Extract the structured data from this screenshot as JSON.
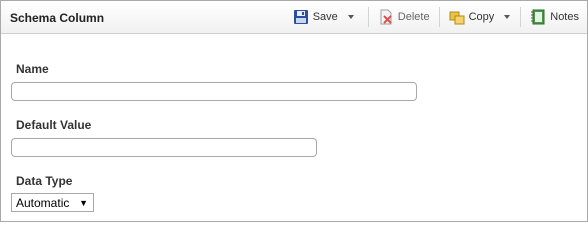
{
  "header": {
    "title": "Schema Column"
  },
  "toolbar": {
    "save_label": "Save",
    "delete_label": "Delete",
    "copy_label": "Copy",
    "notes_label": "Notes"
  },
  "form": {
    "name_label": "Name",
    "name_value": "",
    "default_value_label": "Default Value",
    "default_value_value": "",
    "data_type_label": "Data Type",
    "data_type_selected": "Automatic",
    "dropdown_caret": "▼"
  },
  "colors": {
    "border": "#a9a9a9",
    "header_bg": "#f1f1f1",
    "save_icon": "#2a4f9c",
    "delete_icon": "#c0392b",
    "copy_icon": "#d4a017",
    "notes_icon": "#3c8d3c"
  },
  "icons": {
    "save": "floppy-disk-icon",
    "delete": "delete-document-icon",
    "copy": "copy-folders-icon",
    "notes": "notes-book-icon"
  }
}
